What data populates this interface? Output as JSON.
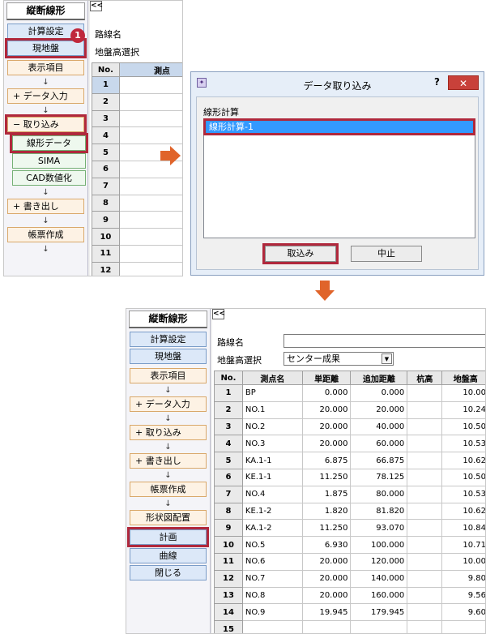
{
  "top_app": {
    "sidebar": {
      "title": "縦断線形",
      "buttons": {
        "calc_settings": "計算設定",
        "existing_ground": "現地盤",
        "display_items": "表示項目",
        "data_input": "+ データ入力",
        "import": "−  取り込み",
        "linear_data": "線形データ",
        "sima": "SIMA",
        "cad_digitize": "CAD数値化",
        "export": "+  書き出し",
        "report": "帳票作成"
      },
      "arrow": "↓",
      "step_badge": "1"
    },
    "main": {
      "collapse": "<<",
      "route_name_label": "路線名",
      "ground_height_label": "地盤高選択",
      "columns": [
        "No.",
        "測点"
      ],
      "rows": [
        "1",
        "2",
        "3",
        "4",
        "5",
        "6",
        "7",
        "8",
        "9",
        "10",
        "11",
        "12"
      ]
    }
  },
  "dialog": {
    "title": "データ取り込み",
    "help": "?",
    "close": "✕",
    "group_label": "線形計算",
    "list_items": [
      "線形計算-1"
    ],
    "ok_button": "取込み",
    "cancel_button": "中止"
  },
  "bottom_app": {
    "sidebar": {
      "title": "縦断線形",
      "buttons": {
        "calc_settings": "計算設定",
        "existing_ground": "現地盤",
        "display_items": "表示項目",
        "data_input": "+ データ入力",
        "import": "+  取り込み",
        "export": "+  書き出し",
        "report": "帳票作成",
        "shape_layout": "形状図配置",
        "plan": "計画",
        "curve": "曲線",
        "close": "閉じる"
      },
      "arrow": "↓"
    },
    "main": {
      "collapse": "<<",
      "route_name_label": "路線名",
      "route_name_value": "",
      "ground_height_label": "地盤高選択",
      "ground_height_value": "センター成果",
      "dropdown_arrow": "▼",
      "columns": [
        "No.",
        "測点名",
        "単距離",
        "追加距離",
        "杭高",
        "地盤高"
      ],
      "rows": [
        {
          "no": "1",
          "name": "BP",
          "single": "0.000",
          "cumulative": "0.000",
          "pile": "",
          "ground": "10.00"
        },
        {
          "no": "2",
          "name": "NO.1",
          "single": "20.000",
          "cumulative": "20.000",
          "pile": "",
          "ground": "10.24"
        },
        {
          "no": "3",
          "name": "NO.2",
          "single": "20.000",
          "cumulative": "40.000",
          "pile": "",
          "ground": "10.50"
        },
        {
          "no": "4",
          "name": "NO.3",
          "single": "20.000",
          "cumulative": "60.000",
          "pile": "",
          "ground": "10.53"
        },
        {
          "no": "5",
          "name": "KA.1-1",
          "single": "6.875",
          "cumulative": "66.875",
          "pile": "",
          "ground": "10.62"
        },
        {
          "no": "6",
          "name": "KE.1-1",
          "single": "11.250",
          "cumulative": "78.125",
          "pile": "",
          "ground": "10.50"
        },
        {
          "no": "7",
          "name": "NO.4",
          "single": "1.875",
          "cumulative": "80.000",
          "pile": "",
          "ground": "10.53"
        },
        {
          "no": "8",
          "name": "KE.1-2",
          "single": "1.820",
          "cumulative": "81.820",
          "pile": "",
          "ground": "10.62"
        },
        {
          "no": "9",
          "name": "KA.1-2",
          "single": "11.250",
          "cumulative": "93.070",
          "pile": "",
          "ground": "10.84"
        },
        {
          "no": "10",
          "name": "NO.5",
          "single": "6.930",
          "cumulative": "100.000",
          "pile": "",
          "ground": "10.71"
        },
        {
          "no": "11",
          "name": "NO.6",
          "single": "20.000",
          "cumulative": "120.000",
          "pile": "",
          "ground": "10.00"
        },
        {
          "no": "12",
          "name": "NO.7",
          "single": "20.000",
          "cumulative": "140.000",
          "pile": "",
          "ground": "9.80"
        },
        {
          "no": "13",
          "name": "NO.8",
          "single": "20.000",
          "cumulative": "160.000",
          "pile": "",
          "ground": "9.56"
        },
        {
          "no": "14",
          "name": "NO.9",
          "single": "19.945",
          "cumulative": "179.945",
          "pile": "",
          "ground": "9.60"
        },
        {
          "no": "15",
          "name": "",
          "single": "",
          "cumulative": "",
          "pile": "",
          "ground": ""
        }
      ]
    }
  },
  "colors": {
    "highlight": "#b0283c",
    "arrow": "#e0642a",
    "selection": "#3399ff"
  }
}
